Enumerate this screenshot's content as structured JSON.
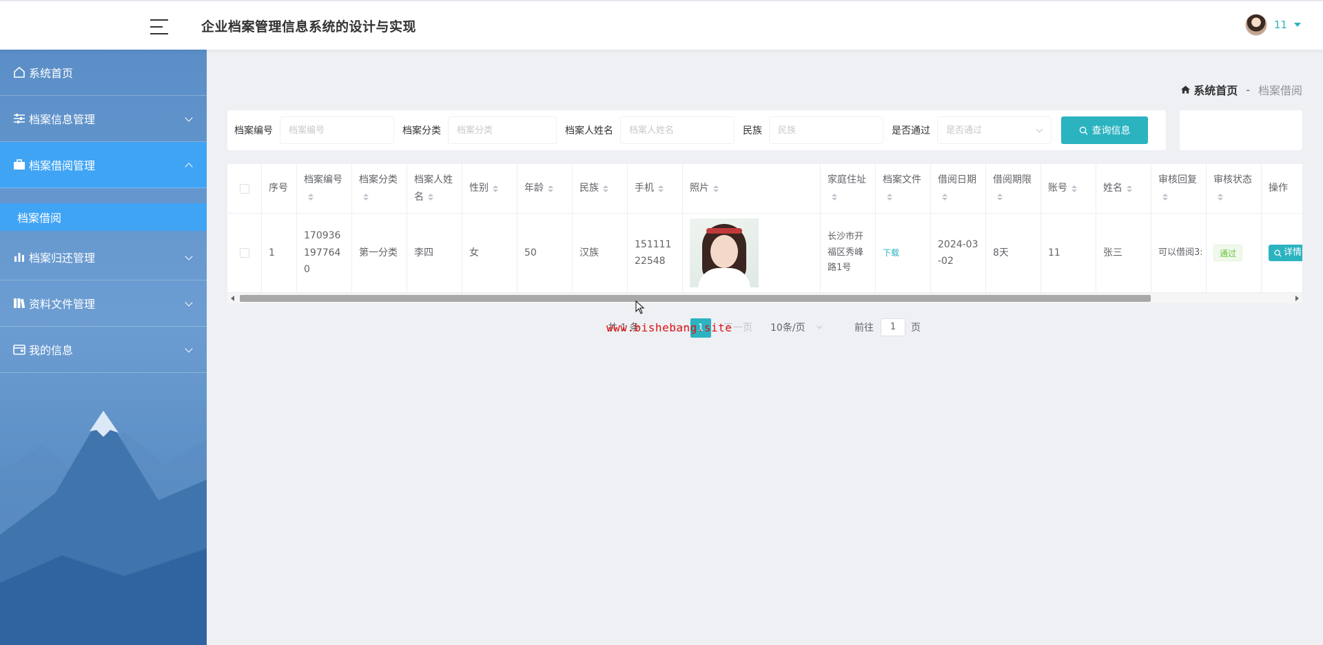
{
  "header": {
    "title": "企业档案管理信息系统的设计与实现",
    "user_name": "11"
  },
  "sidebar": {
    "items": [
      {
        "label": "系统首页",
        "icon": "home-icon"
      },
      {
        "label": "档案信息管理",
        "icon": "sliders-icon"
      },
      {
        "label": "档案借阅管理",
        "icon": "briefcase-icon"
      },
      {
        "label": "档案归还管理",
        "icon": "bar-chart-icon"
      },
      {
        "label": "资料文件管理",
        "icon": "books-icon"
      },
      {
        "label": "我的信息",
        "icon": "wallet-icon"
      }
    ],
    "submenu_active": "档案借阅"
  },
  "breadcrumb": {
    "home": "系统首页",
    "separator": "-",
    "current": "档案借阅"
  },
  "search": {
    "fields": [
      {
        "label": "档案编号",
        "placeholder": "档案编号"
      },
      {
        "label": "档案分类",
        "placeholder": "档案分类"
      },
      {
        "label": "档案人姓名",
        "placeholder": "档案人姓名"
      },
      {
        "label": "民族",
        "placeholder": "民族"
      },
      {
        "label": "是否通过",
        "placeholder": "是否通过"
      }
    ],
    "button": "查询信息"
  },
  "table": {
    "headers": [
      "序号",
      "档案编号",
      "档案分类",
      "档案人姓名",
      "性别",
      "年龄",
      "民族",
      "手机",
      "照片",
      "家庭住址",
      "档案文件",
      "借阅日期",
      "借阅期限",
      "账号",
      "姓名",
      "审核回复",
      "审核状态",
      "操作"
    ],
    "rows": [
      {
        "index": "1",
        "code": "1709361977640",
        "category": "第一分类",
        "person": "李四",
        "gender": "女",
        "age": "50",
        "nation": "汉族",
        "phone": "15111122548",
        "address": "长沙市开福区秀峰路1号",
        "file": "下载",
        "borrow_date": "2024-03-02",
        "period": "8天",
        "account": "11",
        "name": "张三",
        "reply": "可以借阅3:",
        "status": "通过",
        "action": "详情"
      }
    ]
  },
  "pagination": {
    "total": "共 1 条",
    "prev": "上一页",
    "current": "1",
    "next": "下一页",
    "page_size": "10条/页",
    "goto_label": "前往",
    "goto_value": "1",
    "page_suffix": "页"
  },
  "watermark": "www.bishebang.site",
  "colors": {
    "accent": "#2bb3c0",
    "menu_active": "#40a4f5",
    "sidebar": "#5b8ec7"
  }
}
